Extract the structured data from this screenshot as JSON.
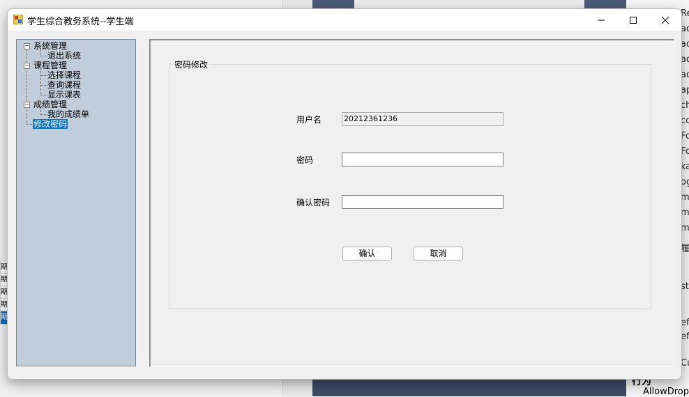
{
  "window": {
    "title": "学生综合教务系统--学生端",
    "minimize_glyph": "—",
    "maximize_glyph": "☐",
    "close_glyph": "✕"
  },
  "tree": {
    "nodes": [
      {
        "label": "系统管理",
        "expander": "−"
      },
      {
        "label": "退出系统"
      },
      {
        "label": "课程管理",
        "expander": "−"
      },
      {
        "label": "选择课程"
      },
      {
        "label": "查询课程"
      },
      {
        "label": "显示课表"
      },
      {
        "label": "成绩管理",
        "expander": "−"
      },
      {
        "label": "我的成绩单"
      },
      {
        "label": "修改密码",
        "selected": true
      }
    ]
  },
  "form": {
    "group_title": "密码修改",
    "username_label": "用户名",
    "username_value": "20212361236",
    "password_label": "密码",
    "password_value": "",
    "confirm_label": "确认密码",
    "confirm_value": "",
    "confirm_button": "确认",
    "cancel_button": "取消"
  },
  "background": {
    "right_rows": [
      "Re",
      "ad",
      "ad",
      "ad",
      "ad",
      "ap",
      "ch",
      "co",
      "Fo",
      "Fo",
      "ka",
      "og",
      "me",
      "me",
      "me",
      "履",
      "ste",
      "ef",
      "ef",
      "Cu"
    ],
    "behavior_label": "行为",
    "allow_drop_label": "AllowDrop",
    "left_strip_label": "期"
  },
  "colors": {
    "tree_background": "#c0cddb",
    "selection": "#0a74d0",
    "window_background": "#f0f0f0"
  }
}
